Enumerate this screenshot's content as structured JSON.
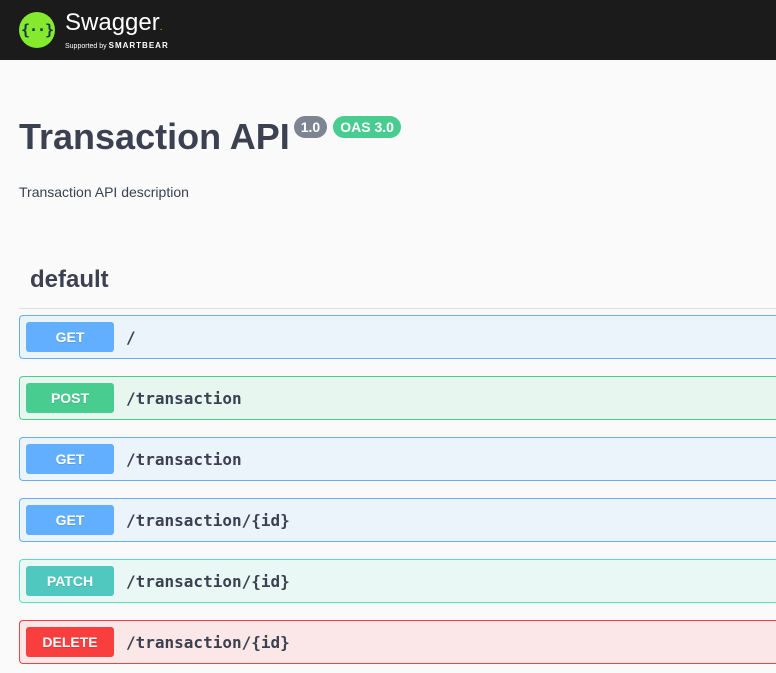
{
  "topbar": {
    "logo_symbol": "{··}",
    "logo_name": "Swagger",
    "logo_dot": ".",
    "logo_sub_prefix": "Supported by",
    "logo_sub_brand": "SMARTBEAR"
  },
  "info": {
    "title": "Transaction API",
    "version": "1.0",
    "oas": "OAS 3.0",
    "description": "Transaction API description"
  },
  "section": {
    "tag": "default",
    "operations": [
      {
        "method": "GET",
        "path": "/"
      },
      {
        "method": "POST",
        "path": "/transaction"
      },
      {
        "method": "GET",
        "path": "/transaction"
      },
      {
        "method": "GET",
        "path": "/transaction/{id}"
      },
      {
        "method": "PATCH",
        "path": "/transaction/{id}"
      },
      {
        "method": "DELETE",
        "path": "/transaction/{id}"
      }
    ]
  },
  "colors": {
    "get": "#61affe",
    "post": "#49cc90",
    "patch": "#50c8c0",
    "delete": "#f93e3e",
    "topbar": "#1b1b1b"
  }
}
